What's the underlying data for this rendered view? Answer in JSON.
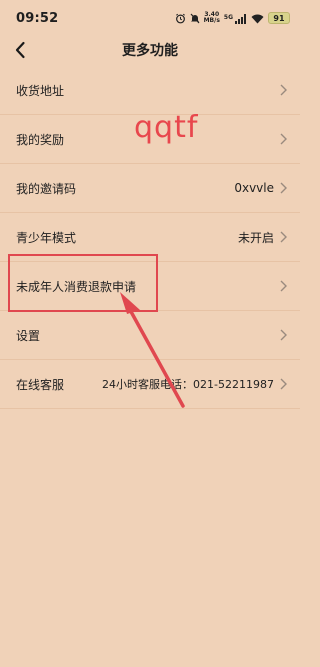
{
  "status_bar": {
    "time": "09:52",
    "net_speed_value": "3.40",
    "net_speed_unit": "MB/s",
    "network_type": "5G",
    "battery": "91"
  },
  "header": {
    "title": "更多功能",
    "back_icon": "chevron-left-icon"
  },
  "menu": [
    {
      "label": "收货地址",
      "value": ""
    },
    {
      "label": "我的奖励",
      "value": ""
    },
    {
      "label": "我的邀请码",
      "value": "0xvvle"
    },
    {
      "label": "青少年模式",
      "value": "未开启"
    },
    {
      "label": "未成年人消费退款申请",
      "value": ""
    },
    {
      "label": "设置",
      "value": ""
    },
    {
      "label": "在线客服",
      "value": "24小时客服电话：021-52211987"
    }
  ],
  "annotation": {
    "text": "qqtf",
    "color": "#e8474d"
  },
  "colors": {
    "background": "#f0d2b8",
    "divider": "#e7c3a5",
    "annotation_red": "#e0484f"
  }
}
